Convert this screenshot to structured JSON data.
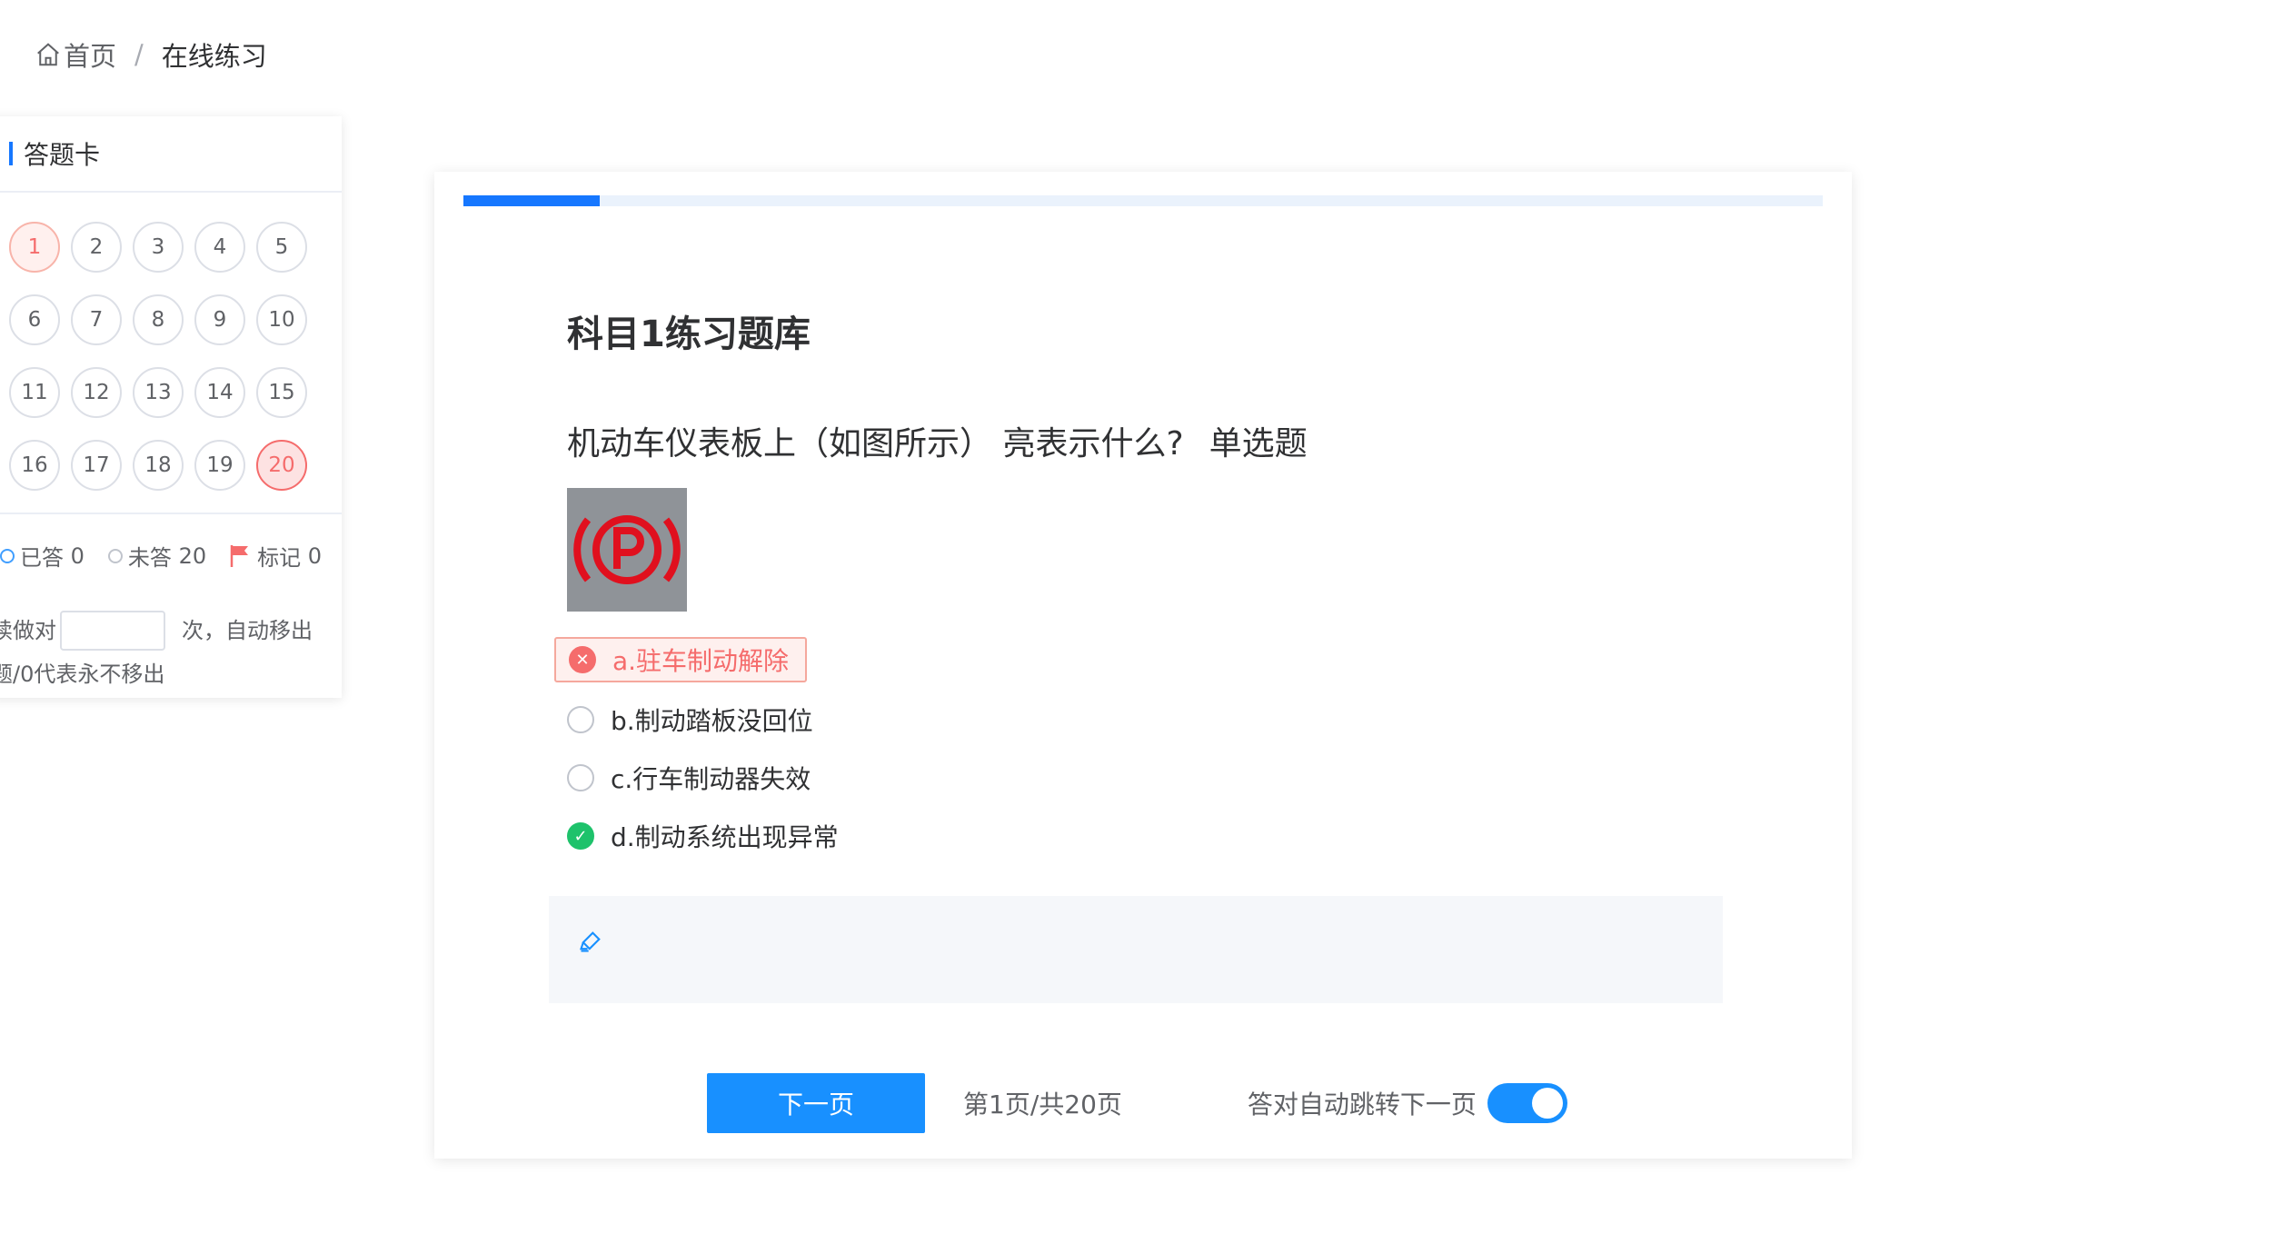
{
  "breadcrumb": {
    "home": "首页",
    "separator": "/",
    "current": "在线练习"
  },
  "answer_card": {
    "title": "答题卡",
    "numbers": [
      "1",
      "2",
      "3",
      "4",
      "5",
      "6",
      "7",
      "8",
      "9",
      "10",
      "11",
      "12",
      "13",
      "14",
      "15",
      "16",
      "17",
      "18",
      "19",
      "20"
    ],
    "current": "1",
    "flagged": "20",
    "legend": {
      "answered_label": "已答",
      "answered_count": "0",
      "unanswered_label": "未答",
      "unanswered_count": "20",
      "marked_label": "标记",
      "marked_count": "0"
    },
    "auto_remove": {
      "prefix": "续做对",
      "suffix": "次，自动移出",
      "note": "题/0代表永不移出",
      "value": ""
    }
  },
  "main": {
    "progress_fraction": 0.1,
    "bank_title": "科目1练习题库",
    "question_text": "机动车仪表板上（如图所示） 亮表示什么?",
    "question_type": "单选题",
    "options": [
      {
        "label": "a.驻车制动解除",
        "state": "wrong"
      },
      {
        "label": "b.制动踏板没回位",
        "state": "none"
      },
      {
        "label": "c.行车制动器失效",
        "state": "none"
      },
      {
        "label": "d.制动系统出现异常",
        "state": "correct"
      }
    ],
    "next_button": "下一页",
    "page_info": "第1页/共20页",
    "auto_next_label": "答对自动跳转下一页",
    "auto_next_on": true
  },
  "colors": {
    "primary": "#1890ff",
    "wrong": "#f56c6c",
    "correct": "#1ec26b"
  }
}
